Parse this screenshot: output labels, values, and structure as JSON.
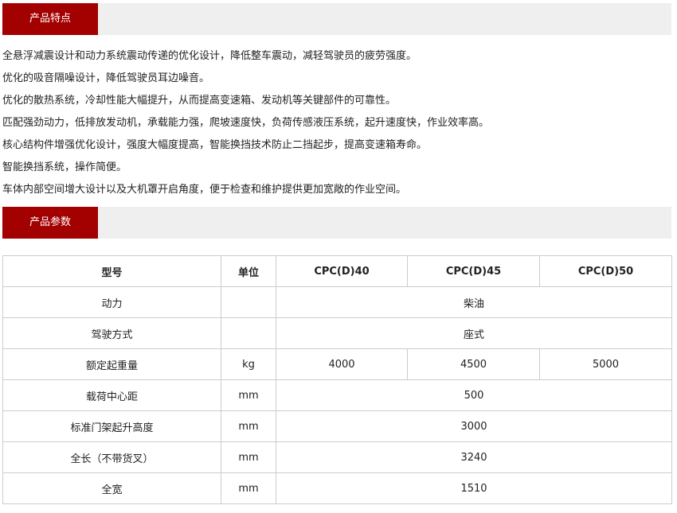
{
  "features_header": "产品特点",
  "features": [
    "全悬浮减震设计和动力系统震动传递的优化设计，降低整车震动，减轻驾驶员的疲劳强度。",
    "优化的吸音隔噪设计，降低驾驶员耳边噪音。",
    "优化的散热系统，冷却性能大幅提升，从而提高变速箱、发动机等关键部件的可靠性。",
    "匹配强劲动力，低排放发动机，承载能力强，爬坡速度快，负荷传感液压系统，起升速度快，作业效率高。",
    "核心结构件增强优化设计，强度大幅度提高，智能换挡技术防止二挡起步，提高变速箱寿命。",
    "智能换挡系统，操作简便。",
    "车体内部空间增大设计以及大机罩开启角度，便于检查和维护提供更加宽敞的作业空间。"
  ],
  "params_header": "产品参数",
  "table": {
    "headers": [
      "型号",
      "单位",
      "CPC(D)40",
      "CPC(D)45",
      "CPC(D)50"
    ],
    "rows": [
      {
        "label": "动力",
        "unit": "",
        "value": "柴油"
      },
      {
        "label": "驾驶方式",
        "unit": "",
        "value": "座式"
      },
      {
        "label": "额定起重量",
        "unit": "kg",
        "values": [
          "4000",
          "4500",
          "5000"
        ]
      },
      {
        "label": "载荷中心距",
        "unit": "mm",
        "value": "500"
      },
      {
        "label": "标准门架起升高度",
        "unit": "mm",
        "value": "3000"
      },
      {
        "label": "全长（不带货叉）",
        "unit": "mm",
        "value": "3240"
      },
      {
        "label": "全宽",
        "unit": "mm",
        "value": "1510"
      }
    ]
  },
  "colors": {
    "accent": "#a30000",
    "header_bar": "#efefef",
    "border": "#cccccc"
  }
}
